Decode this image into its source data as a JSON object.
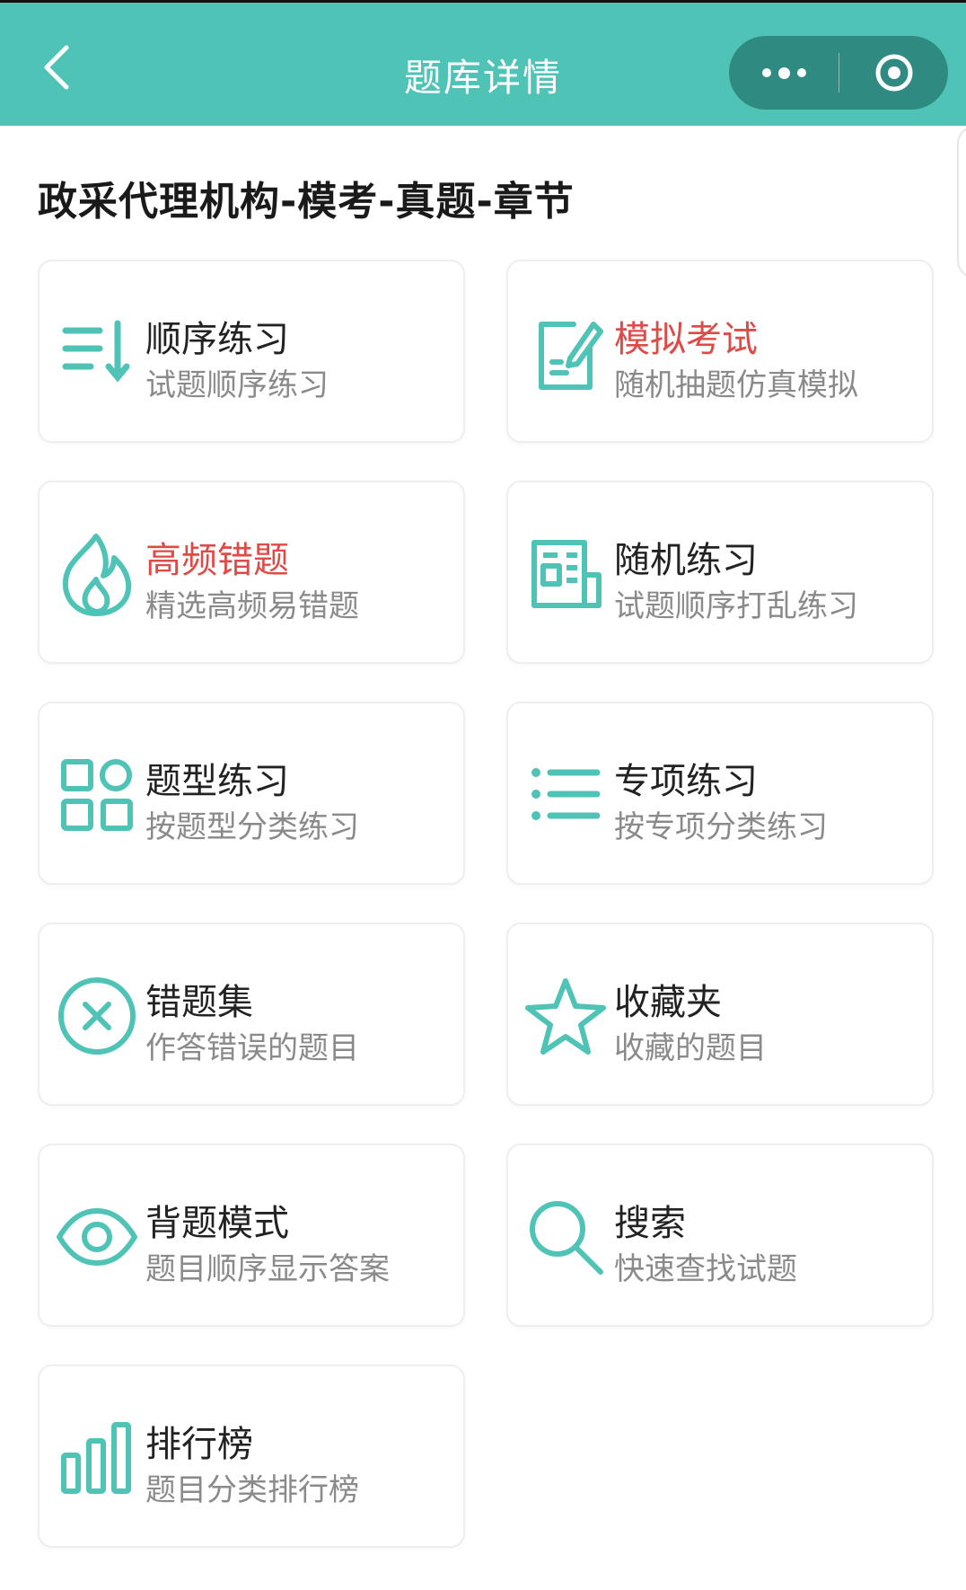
{
  "nav": {
    "title": "题库详情",
    "back_icon": "chevron-left-icon",
    "more_icon": "more-dots-icon",
    "close_icon": "target-circle-icon"
  },
  "page": {
    "heading": "政采代理机构-模考-真题-章节"
  },
  "colors": {
    "accent": "#4fc3b5",
    "capsule": "#2f8b82",
    "hot": "#e04a46",
    "subtitle": "#8a8a8a"
  },
  "menu": [
    {
      "title": "顺序练习",
      "subtitle": "试题顺序练习",
      "icon": "sort-descending-icon",
      "highlight": false
    },
    {
      "title": "模拟考试",
      "subtitle": "随机抽题仿真模拟",
      "icon": "edit-document-icon",
      "highlight": true
    },
    {
      "title": "高频错题",
      "subtitle": "精选高频易错题",
      "icon": "flame-icon",
      "highlight": true
    },
    {
      "title": "随机练习",
      "subtitle": "试题顺序打乱练习",
      "icon": "newspaper-icon",
      "highlight": false
    },
    {
      "title": "题型练习",
      "subtitle": "按题型分类练习",
      "icon": "grid-icon",
      "highlight": false
    },
    {
      "title": "专项练习",
      "subtitle": "按专项分类练习",
      "icon": "list-icon",
      "highlight": false
    },
    {
      "title": "错题集",
      "subtitle": "作答错误的题目",
      "icon": "close-circle-icon",
      "highlight": false
    },
    {
      "title": "收藏夹",
      "subtitle": "收藏的题目",
      "icon": "star-icon",
      "highlight": false
    },
    {
      "title": "背题模式",
      "subtitle": "题目顺序显示答案",
      "icon": "eye-icon",
      "highlight": false
    },
    {
      "title": "搜索",
      "subtitle": "快速查找试题",
      "icon": "search-icon",
      "highlight": false
    },
    {
      "title": "排行榜",
      "subtitle": "题目分类排行榜",
      "icon": "bar-chart-icon",
      "highlight": false
    }
  ]
}
